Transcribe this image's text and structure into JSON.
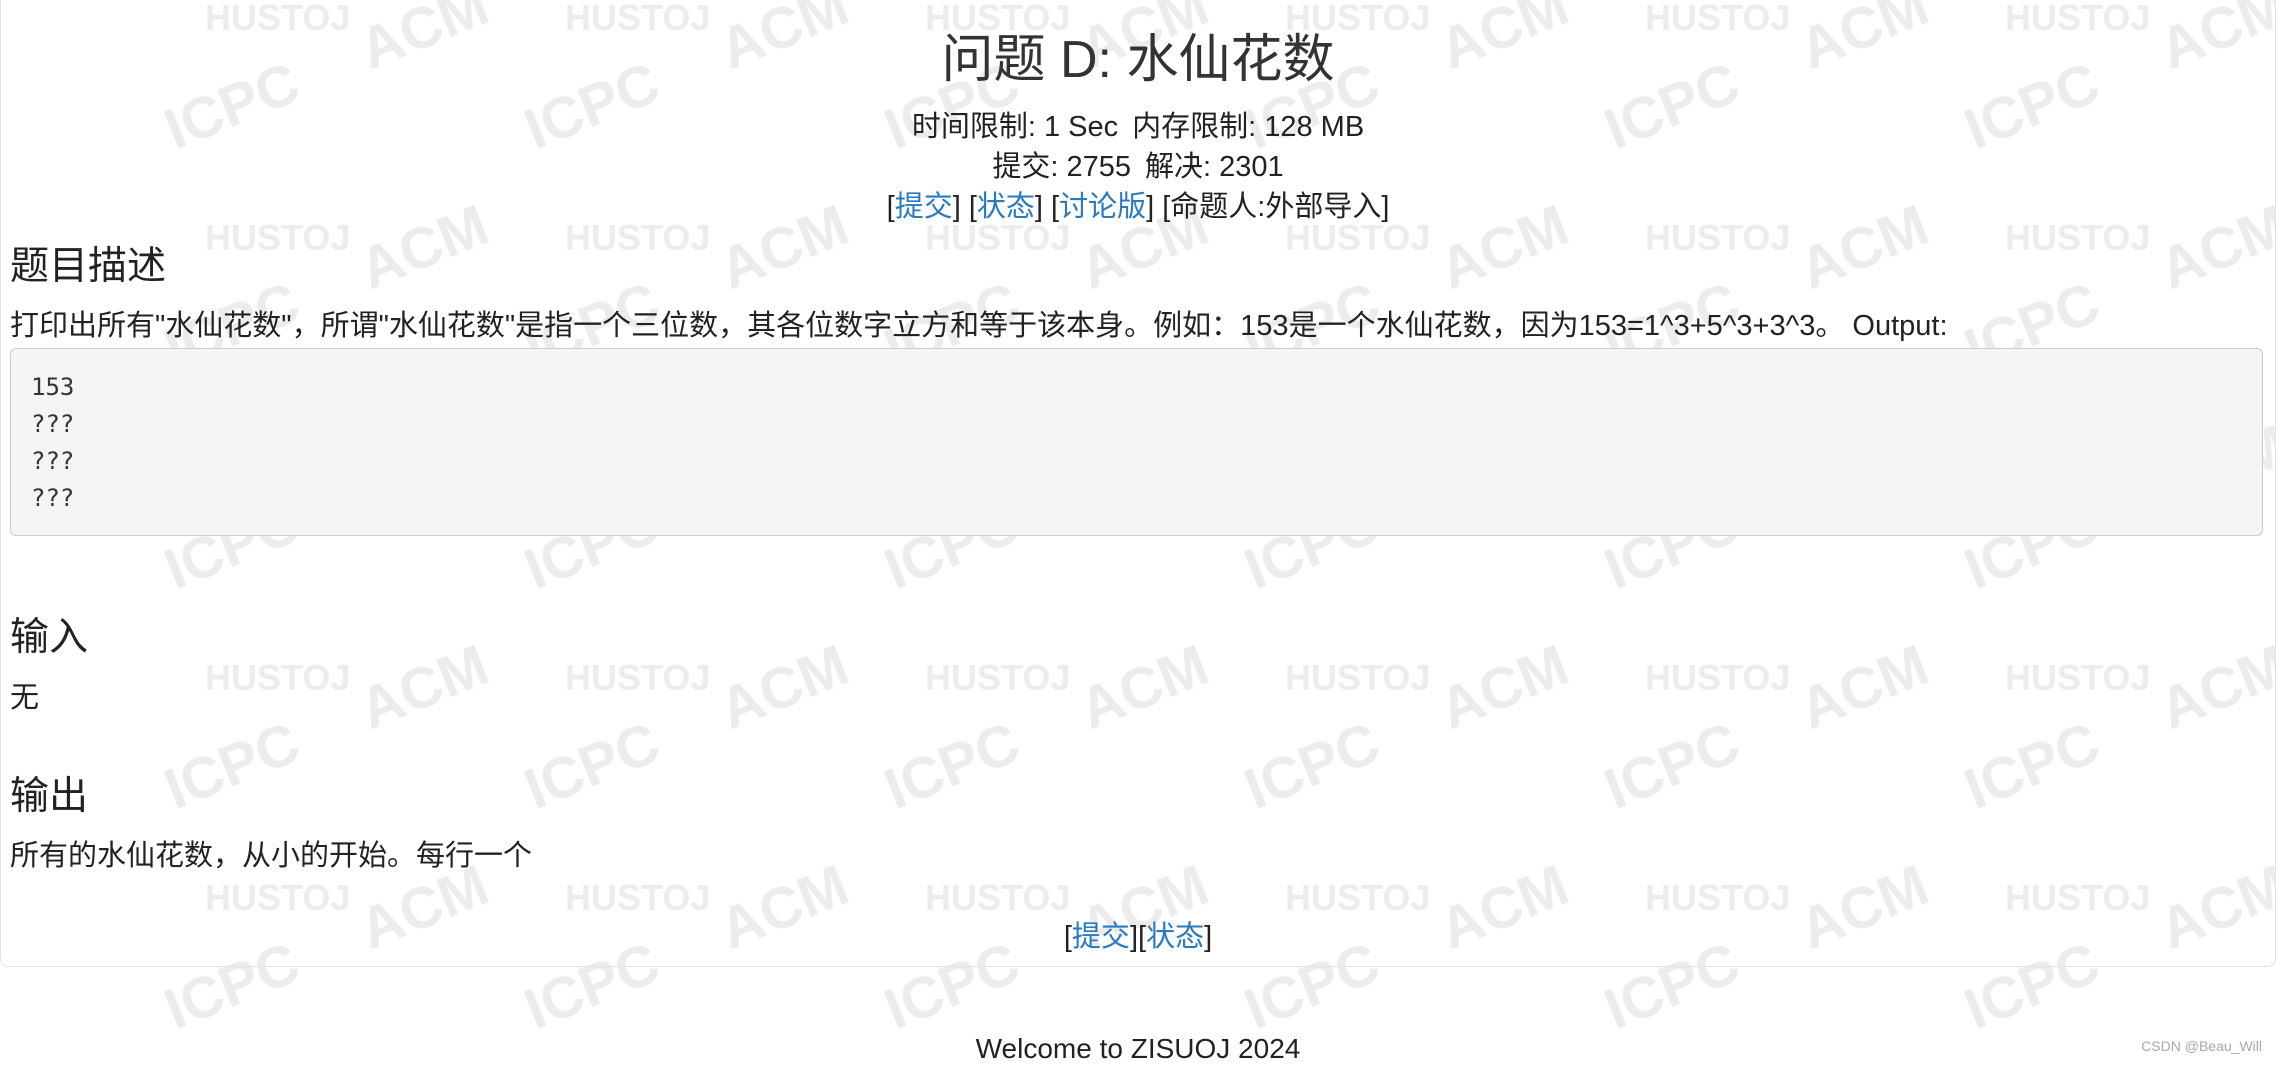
{
  "problem": {
    "title": "问题 D: 水仙花数",
    "time_limit": "时间限制: 1 Sec",
    "memory_limit": "内存限制: 128 MB",
    "submit_count": "提交: 2755",
    "solved_count": "解决: 2301",
    "links": {
      "submit": "提交",
      "status": "状态",
      "discuss": "讨论版",
      "author": "[命题人:外部导入]"
    }
  },
  "sections": {
    "description": {
      "heading": "题目描述",
      "text": "打印出所有\"水仙花数\"，所谓\"水仙花数\"是指一个三位数，其各位数字立方和等于该本身。例如：153是一个水仙花数，因为153=1^3+5^3+3^3。 Output:",
      "code_lines": [
        "153",
        "???",
        "???",
        "???"
      ]
    },
    "input": {
      "heading": "输入",
      "text": "无"
    },
    "output": {
      "heading": "输出",
      "text": "所有的水仙花数，从小的开始。每行一个"
    }
  },
  "footer": {
    "submit": "提交",
    "status": "状态",
    "welcome": "Welcome to ZISUOJ 2024",
    "credit": "CSDN @Beau_Will"
  },
  "watermark": {
    "words": [
      "HUSTOJ",
      "ACM",
      "ICPC"
    ],
    "color": "#ececec"
  },
  "colors": {
    "link": "#2a7ac0",
    "text": "#222222",
    "code_bg": "#f5f5f5"
  }
}
